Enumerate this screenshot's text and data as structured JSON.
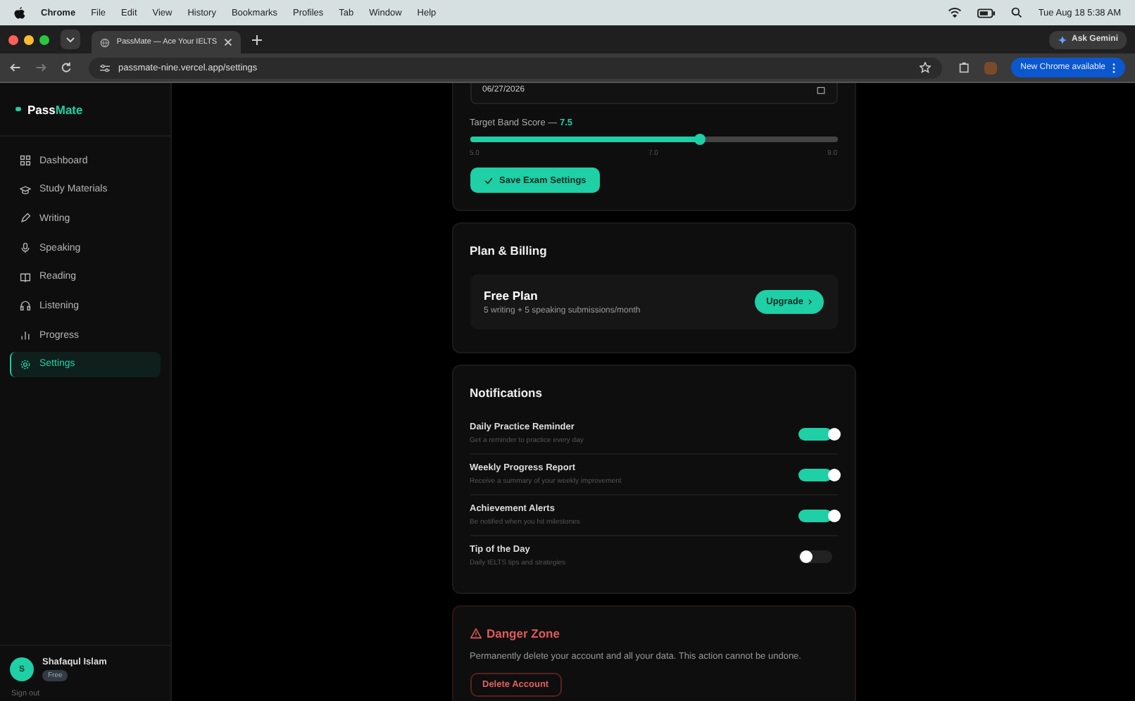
{
  "menu_bar": {
    "app": "Chrome",
    "items": [
      "File",
      "Edit",
      "View",
      "History",
      "Bookmarks",
      "Profiles",
      "Tab",
      "Window",
      "Help"
    ],
    "clock": "Tue Aug 18  5:38 AM"
  },
  "browser": {
    "tab_title": "PassMate — Ace Your IELTS",
    "url": "passmate-nine.vercel.app/settings",
    "ask_button": "Ask Gemini",
    "update_button": "New Chrome available"
  },
  "sidebar": {
    "logo_prefix": "Pass",
    "logo_suffix": "Mate",
    "items": [
      {
        "label": "Dashboard",
        "selected": false
      },
      {
        "label": "Study Materials",
        "selected": false
      },
      {
        "label": "Writing",
        "selected": false
      },
      {
        "label": "Speaking",
        "selected": false
      },
      {
        "label": "Reading",
        "selected": false
      },
      {
        "label": "Listening",
        "selected": false
      },
      {
        "label": "Progress",
        "selected": false
      },
      {
        "label": "Settings",
        "selected": true
      }
    ],
    "user": {
      "initial": "S",
      "name": "Shafaqul Islam",
      "plan": "Free"
    },
    "sign_out": "Sign out"
  },
  "exam": {
    "date": "06/27/2026",
    "band_label": "Target Band Score —",
    "band_value": "7.5",
    "slider": {
      "level": 0.625
    },
    "ticks": [
      "5.0",
      "7.0",
      "9.0"
    ],
    "save_button": "Save Exam Settings"
  },
  "plan": {
    "title": "Plan & Billing",
    "plan_name": "Free Plan",
    "plan_desc": "5 writing + 5 speaking submissions/month",
    "upgrade_button": "Upgrade"
  },
  "notifications": {
    "title": "Notifications",
    "items": [
      {
        "title": "Daily Practice Reminder",
        "description": "Get a reminder to practice every day",
        "on": true
      },
      {
        "title": "Weekly Progress Report",
        "description": "Receive a summary of your weekly improvement",
        "on": true
      },
      {
        "title": "Achievement Alerts",
        "description": "Be notified when you hit milestones",
        "on": true
      },
      {
        "title": "Tip of the Day",
        "description": "Daily IELTS tips and strategies",
        "on": false
      }
    ]
  },
  "danger": {
    "title": "Danger Zone",
    "text": "Permanently delete your account and all your data. This action cannot be undone.",
    "button": "Delete Account"
  }
}
